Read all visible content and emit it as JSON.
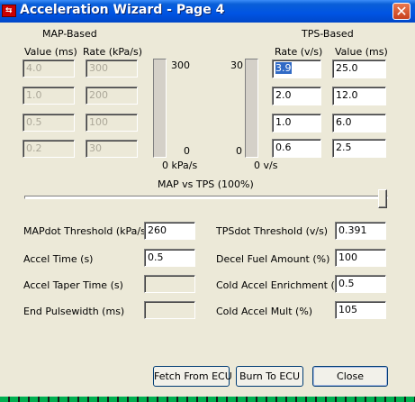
{
  "window": {
    "title": "Acceleration Wizard - Page 4",
    "app_icon_glyph": "⇆",
    "close_glyph": "✕"
  },
  "map": {
    "heading": "MAP-Based",
    "col_value": "Value (ms)",
    "col_rate": "Rate (kPa/s)",
    "rows": [
      {
        "value": "4.0",
        "rate": "300"
      },
      {
        "value": "1.0",
        "rate": "200"
      },
      {
        "value": "0.5",
        "rate": "100"
      },
      {
        "value": "0.2",
        "rate": "30"
      }
    ],
    "bar_max": "300",
    "bar_min": "0",
    "bar_unit": "0 kPa/s",
    "bar_level": 0
  },
  "tps": {
    "heading": "TPS-Based",
    "col_rate": "Rate (v/s)",
    "col_value": "Value (ms)",
    "rows": [
      {
        "rate": "3.9",
        "value": "25.0"
      },
      {
        "rate": "2.0",
        "value": "12.0"
      },
      {
        "rate": "1.0",
        "value": "6.0"
      },
      {
        "rate": "0.6",
        "value": "2.5"
      }
    ],
    "bar_max": "30",
    "bar_min": "0",
    "bar_unit": "0 v/s",
    "bar_level": 0
  },
  "slider": {
    "label": "MAP vs TPS (100%)",
    "value_percent": 100
  },
  "settings": {
    "mapdot_label": "MAPdot Threshold (kPa/s)",
    "mapdot_value": "260",
    "accel_time_label": "Accel Time (s)",
    "accel_time_value": "0.5",
    "accel_taper_label": "Accel Taper Time (s)",
    "accel_taper_value": "",
    "end_pw_label": "End Pulsewidth (ms)",
    "end_pw_value": "",
    "tpsdot_label": "TPSdot Threshold (v/s)",
    "tpsdot_value": "0.391",
    "decel_label": "Decel Fuel Amount (%)",
    "decel_value": "100",
    "cold_enrich_label": "Cold Accel Enrichment (ms)",
    "cold_enrich_value": "0.5",
    "cold_mult_label": "Cold Accel Mult (%)",
    "cold_mult_value": "105"
  },
  "buttons": {
    "fetch": "Fetch From ECU",
    "burn": "Burn To ECU",
    "close": "Close"
  }
}
